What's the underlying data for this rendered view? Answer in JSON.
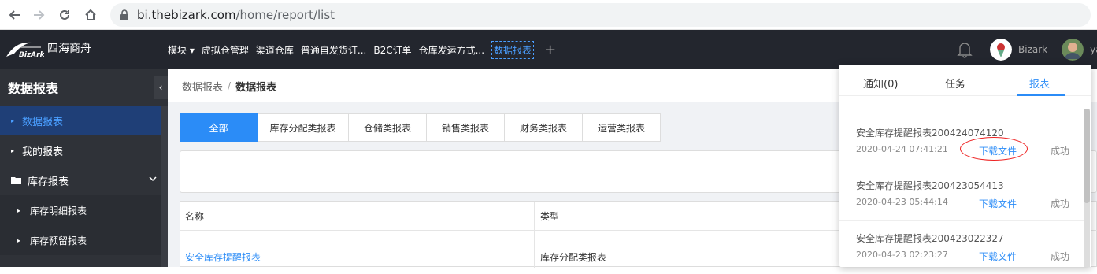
{
  "browser": {
    "url_host": "bi.thebizark.com",
    "url_path": "/home/report/list"
  },
  "app": {
    "logo_text": "四海商舟",
    "nav_items": [
      "模块",
      "虚拟仓管理",
      "渠道仓库",
      "普通自发货订...",
      "B2C订单",
      "仓库发运方式...",
      "数据报表"
    ],
    "active_nav": "数据报表",
    "user_label": "Bizark",
    "user2_label": "yac"
  },
  "sidebar": {
    "title": "数据报表",
    "items": [
      {
        "label": "数据报表",
        "active": true
      },
      {
        "label": "我的报表"
      },
      {
        "label": "库存报表"
      }
    ],
    "subitems": [
      "库存明细报表",
      "库存预留报表"
    ]
  },
  "breadcrumb": {
    "parent": "数据报表",
    "separator": "/",
    "current": "数据报表"
  },
  "tabs": [
    "全部",
    "库存分配类报表",
    "仓储类报表",
    "销售类报表",
    "财务类报表",
    "运营类报表"
  ],
  "table": {
    "headers": [
      "名称",
      "类型"
    ],
    "rows": [
      {
        "name": "安全库存提醒报表",
        "type": "库存分配类报表"
      }
    ]
  },
  "dropdown": {
    "tabs": [
      "通知(0)",
      "任务",
      "报表"
    ],
    "active_tab": "报表",
    "notifications": [
      {
        "title": "安全库存提醒报表200424074120",
        "time": "2020-04-24 07:41:21",
        "action": "下载文件",
        "status": "成功",
        "highlighted": true
      },
      {
        "title": "安全库存提醒报表200423054413",
        "time": "2020-04-23 05:44:14",
        "action": "下载文件",
        "status": "成功"
      },
      {
        "title": "安全库存提醒报表200423022327",
        "time": "2020-04-23 02:23:27",
        "action": "下载文件",
        "status": "成功"
      }
    ]
  },
  "colors": {
    "topbar": "#23262e",
    "sidebar": "#2f3238",
    "accent": "#2b8cf7",
    "highlight_circle": "#e22222"
  }
}
